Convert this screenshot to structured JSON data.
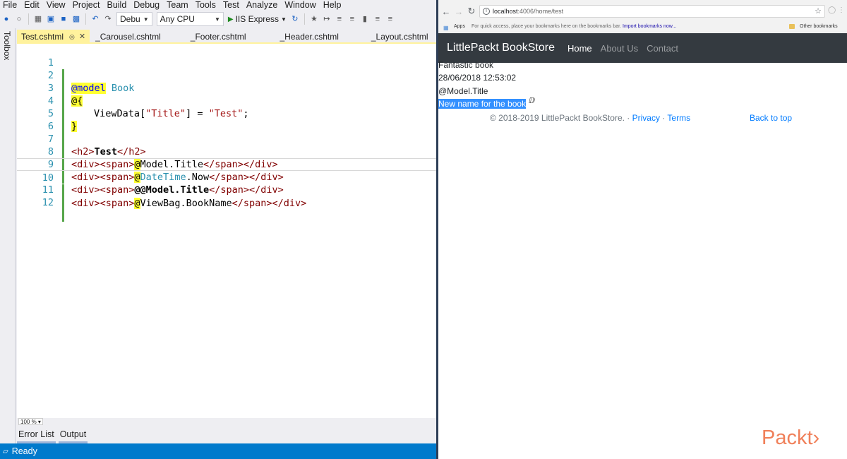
{
  "vs": {
    "menu": [
      "File",
      "Edit",
      "View",
      "Project",
      "Build",
      "Debug",
      "Team",
      "Tools",
      "Test",
      "Analyze",
      "Window",
      "Help"
    ],
    "toolbar": {
      "config": "Debu",
      "platform": "Any CPU",
      "run_target": "IIS Express"
    },
    "toolbox_label": "Toolbox",
    "tabs": [
      {
        "label": "Test.cshtml",
        "active": true
      },
      {
        "label": "_Carousel.cshtml",
        "active": false
      },
      {
        "label": "_Footer.cshtml",
        "active": false
      },
      {
        "label": "_Header.cshtml",
        "active": false
      },
      {
        "label": "_Layout.cshtml",
        "active": false
      }
    ],
    "line_numbers": [
      "1",
      "2",
      "3",
      "4",
      "5",
      "6",
      "7",
      "8",
      "9",
      "10",
      "11",
      "12"
    ],
    "code": {
      "l1_at": "@model",
      "l1_type": "Book",
      "l2": "@{",
      "l3_a": "ViewData[",
      "l3_b": "\"Title\"",
      "l3_c": "] = ",
      "l3_d": "\"Test\"",
      "l3_e": ";",
      "l4": "}",
      "l6_open": "<h2>",
      "l6_text": "Test",
      "l6_close": "</h2>",
      "l7_open": "<div><span>",
      "l7_at": "@",
      "l7_expr": "Model.Title",
      "l7_close": "</span></div>",
      "l8_open": "<div><span>",
      "l8_at": "@",
      "l8_type": "DateTime",
      "l8_rest": ".Now",
      "l8_close": "</span></div>",
      "l9_open": "<div><span>",
      "l9_text": "@@Model.Title",
      "l9_close": "</span></div>",
      "l10_open": "<div><span>",
      "l10_at": "@",
      "l10_expr": "ViewBag.BookName",
      "l10_close": "</span></div>"
    },
    "zoom": "100 %",
    "bottom_tabs": [
      "Error List",
      "Output"
    ],
    "status": "Ready"
  },
  "browser": {
    "url_host": "localhost",
    "url_path": ":4006/home/test",
    "bookmarks": {
      "apps": "Apps",
      "hint": "For quick access, place your bookmarks here on the bookmarks bar.",
      "import": "Import bookmarks now...",
      "other": "Other bookmarks"
    },
    "site": {
      "brand": "LittlePackt BookStore",
      "nav": [
        "Home",
        "About Us",
        "Contact"
      ],
      "lines": [
        "Fantastic book",
        "28/06/2018 12:53:02",
        "@Model.Title",
        "New name for the book"
      ],
      "footer_copy": "© 2018-2019 LittlePackt BookStore. · ",
      "footer_privacy": "Privacy",
      "footer_sep": " · ",
      "footer_terms": "Terms",
      "back_to_top": "Back to top"
    }
  },
  "watermark": "Packt>",
  "colors": {
    "vs_status": "#007acc",
    "active_tab": "#fff29d",
    "razor_highlight": "#ffff33",
    "navbar": "#343a40",
    "selection": "#3390ff",
    "link": "#007bff",
    "packt": "#f0805a"
  }
}
